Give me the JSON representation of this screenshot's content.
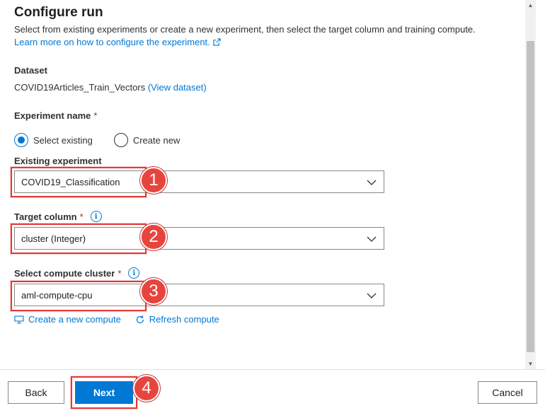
{
  "header": {
    "title": "Configure run",
    "subtitle": "Select from existing experiments or create a new experiment, then select the target column and training compute.",
    "learn_more": "Learn more on how to configure the experiment."
  },
  "dataset": {
    "label": "Dataset",
    "name": "COVID19Articles_Train_Vectors",
    "view_link": "(View dataset)"
  },
  "experiment": {
    "label": "Experiment name",
    "required_mark": "*",
    "options": [
      "Select existing",
      "Create new"
    ],
    "selected": "Select existing"
  },
  "existing_experiment": {
    "label": "Existing experiment",
    "value": "COVID19_Classification"
  },
  "target_column": {
    "label": "Target column",
    "required_mark": "*",
    "value": "cluster (Integer)"
  },
  "compute_cluster": {
    "label": "Select compute cluster",
    "required_mark": "*",
    "value": "aml-compute-cpu"
  },
  "links": {
    "create_compute": "Create a new compute",
    "refresh_compute": "Refresh compute"
  },
  "markers": [
    "1",
    "2",
    "3",
    "4"
  ],
  "footer": {
    "back": "Back",
    "next": "Next",
    "cancel": "Cancel"
  },
  "colors": {
    "accent": "#0078d4",
    "highlight": "#e3393a",
    "required": "#a4262c"
  }
}
